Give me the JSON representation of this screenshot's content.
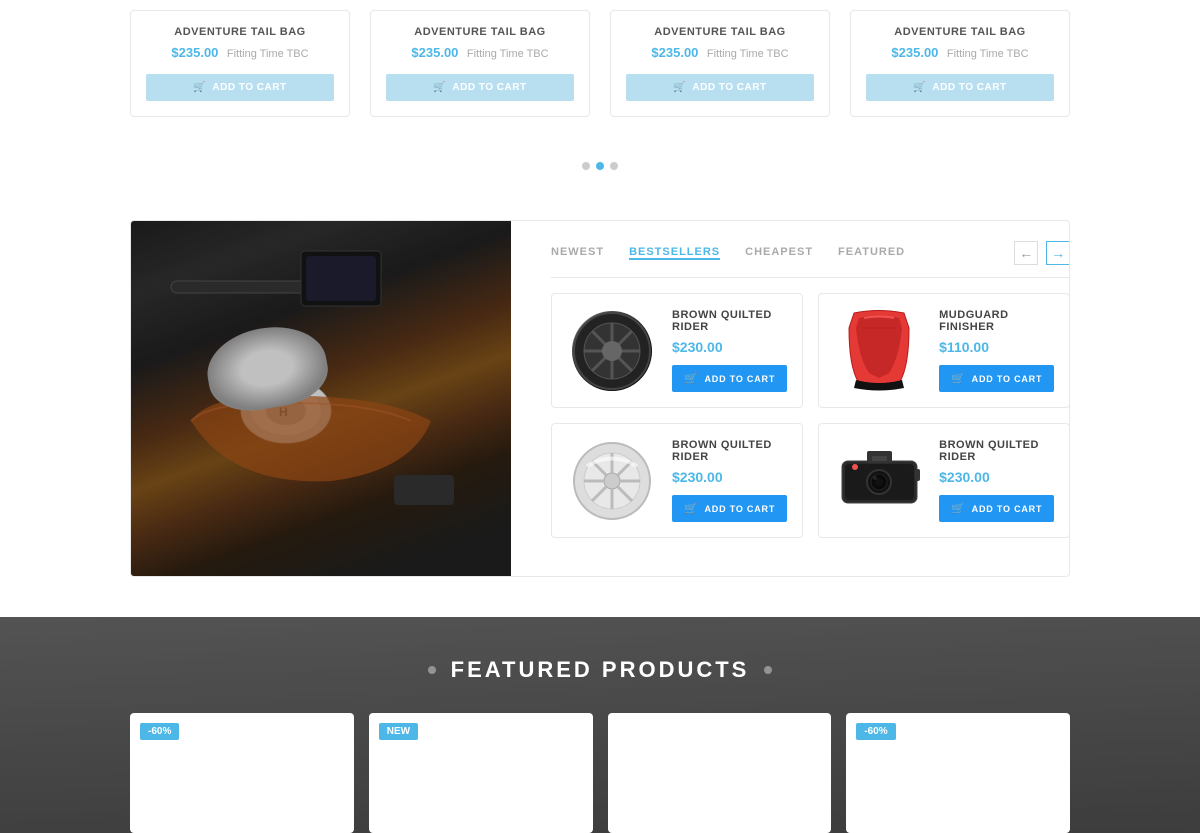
{
  "topCards": [
    {
      "title": "ADVENTURE TAIL BAG",
      "price": "$235.00",
      "fittingTime": "Fitting Time TBC",
      "addToCart": "ADD TO CART"
    },
    {
      "title": "ADVENTURE TAIL BAG",
      "price": "$235.00",
      "fittingTime": "Fitting Time TBC",
      "addToCart": "ADD TO CART"
    },
    {
      "title": "ADVENTURE TAIL BAG",
      "price": "$235.00",
      "fittingTime": "Fitting Time TBC",
      "addToCart": "ADD TO CART"
    },
    {
      "title": "ADVENTURE TAIL BAG",
      "price": "$235.00",
      "fittingTime": "Fitting Time TBC",
      "addToCart": "ADD TO CART"
    }
  ],
  "tabs": [
    {
      "label": "NEWEST",
      "active": false
    },
    {
      "label": "BESTSELLERS",
      "active": true
    },
    {
      "label": "CHEAPEST",
      "active": false
    },
    {
      "label": "FEATURED",
      "active": false
    }
  ],
  "navPrev": "←",
  "navNext": "→",
  "products": [
    {
      "name": "BROWN QUILTED RIDER",
      "price": "$230.00",
      "addToCart": "ADD TO CART",
      "type": "wheel-dark"
    },
    {
      "name": "MUDGUARD FINISHER",
      "price": "$110.00",
      "addToCart": "ADD TO CART",
      "type": "seat"
    },
    {
      "name": "BROWN QUILTED RIDER",
      "price": "$230.00",
      "addToCart": "ADD TO CART",
      "type": "wheel-silver"
    },
    {
      "name": "BROWN QUILTED RIDER",
      "price": "$230.00",
      "addToCart": "ADD TO CART",
      "type": "dashcam"
    }
  ],
  "featuredSection": {
    "title": "FEATURED PRODUCTS"
  },
  "featuredCards": [
    {
      "badge": "-60%",
      "badgeType": "sale"
    },
    {
      "badge": "NEW",
      "badgeType": "new"
    },
    {
      "badge": "",
      "badgeType": ""
    },
    {
      "badge": "-60%",
      "badgeType": "sale"
    }
  ]
}
